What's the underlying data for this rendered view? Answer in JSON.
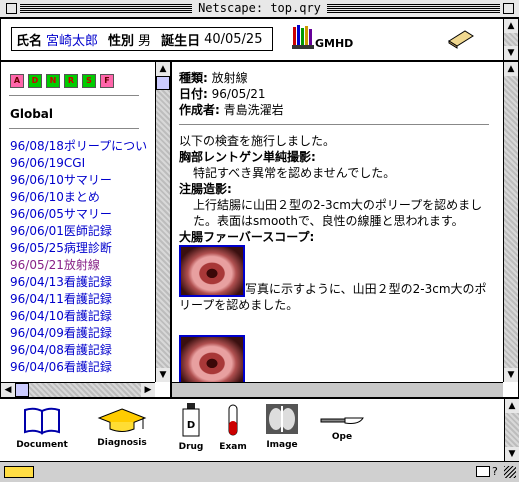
{
  "window": {
    "title": "Netscape: top.qry"
  },
  "patient": {
    "name_label": "氏名",
    "name": "宮崎太郎",
    "sex_label": "性別",
    "sex": "男",
    "dob_label": "誕生日",
    "dob": "40/05/25"
  },
  "logo": {
    "text": "GMHD"
  },
  "nav": {
    "tool_buttons": [
      "A",
      "D",
      "N",
      "R",
      "S",
      "F"
    ],
    "heading": "Global",
    "items": [
      "96/08/18ポリープについ",
      "96/06/19CGI",
      "96/06/10サマリー",
      "96/06/10まとめ",
      "96/06/05サマリー",
      "96/06/01医師記録",
      "96/05/25病理診断",
      "96/05/21放射線",
      "96/04/13看護記録",
      "96/04/11看護記録",
      "96/04/10看護記録",
      "96/04/09看護記録",
      "96/04/08看護記録",
      "96/04/06看護記録"
    ]
  },
  "report": {
    "type_label": "種類:",
    "type": "放射線",
    "date_label": "日付:",
    "date": "96/05/21",
    "author_label": "作成者:",
    "author": "青島洗濯岩",
    "intro": "以下の検査を施行しました。",
    "sec1_title": "胸部レントゲン単純撮影:",
    "sec1_body": "特記すべき異常を認めませんでした。",
    "sec2_title": "注腸造影:",
    "sec2_body": "上行結腸に山田２型の2-3cm大のポリープを認めました。表面はsmoothで、良性の線腫と思われます。",
    "sec3_title": "大腸ファーバースコープ:",
    "sec3_caption": "写真に示すように、山田２型の2-3cm大のポリープを認めました。"
  },
  "toolbar": {
    "document": "Document",
    "diagnosis": "Diagnosis",
    "drug": "Drug",
    "exam": "Exam",
    "image": "Image",
    "ope": "Ope",
    "drug_glyph": "D"
  },
  "colors": {
    "link": "#0000cc",
    "visited": "#882288",
    "accent": "#0000cc"
  }
}
